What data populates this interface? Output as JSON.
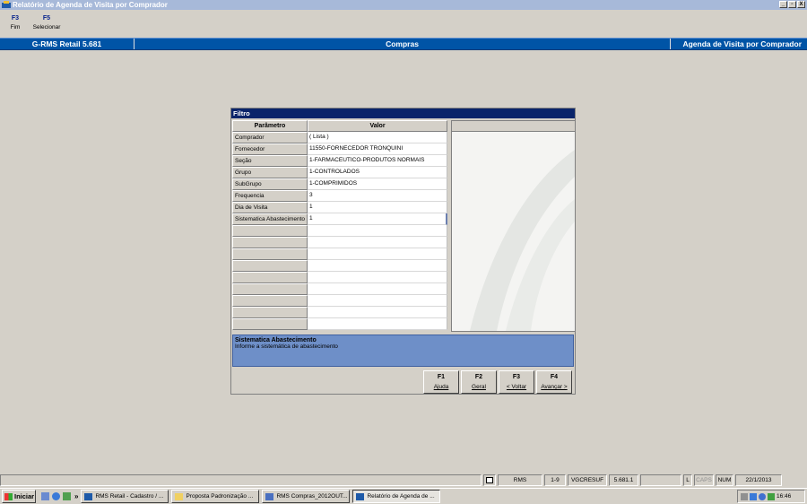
{
  "window": {
    "title": "Relatório de Agenda de Visita por Comprador",
    "controls": [
      "_",
      "▫",
      "X"
    ]
  },
  "fkeys": [
    {
      "key": "F3",
      "label": "Fim"
    },
    {
      "key": "F5",
      "label": "Selecionar"
    }
  ],
  "header": {
    "product": "G-RMS Retail 5.681",
    "module": "Compras",
    "screen": "Agenda de Visita por Comprador"
  },
  "dialog": {
    "title": "Filtro",
    "col_param": "Parâmetro",
    "col_value": "Valor",
    "rows": [
      {
        "param": "Comprador",
        "value": "( Lista )"
      },
      {
        "param": "Fornecedor",
        "value": "11550-FORNECEDOR TRONQUINI"
      },
      {
        "param": "Seção",
        "value": "1-FARMACEUTICO-PRODUTOS NORMAIS"
      },
      {
        "param": "Grupo",
        "value": "1-CONTROLADOS"
      },
      {
        "param": "SubGrupo",
        "value": "1-COMPRIMIDOS"
      },
      {
        "param": "Frequencia",
        "value": "3"
      },
      {
        "param": "Dia de Visita",
        "value": "1"
      },
      {
        "param": "Sistematica Abastecimento",
        "value": "1"
      }
    ],
    "desc_title": "Sistematica Abastecimento",
    "desc_text": "Informe a sistemática de abastecimento",
    "buttons": [
      {
        "key": "F1",
        "label": "Ajuda"
      },
      {
        "key": "F2",
        "label": "Geral"
      },
      {
        "key": "F3",
        "label": "< Voltar"
      },
      {
        "key": "F4",
        "label": "Avançar >"
      }
    ]
  },
  "statusbar": {
    "system": "RMS",
    "page": "1-9",
    "user": "VGCRESUF",
    "version": "5.681.1",
    "l": "L",
    "caps": "CAPS",
    "num": "NUM",
    "date": "22/1/2013"
  },
  "taskbar": {
    "start": "Iniciar",
    "tasks": [
      "RMS Retail - Cadastro / ...",
      "Proposta Padronização ...",
      "RMS Compras_2012OUT...",
      "Relatório de Agenda de ..."
    ],
    "clock": "16:46"
  }
}
